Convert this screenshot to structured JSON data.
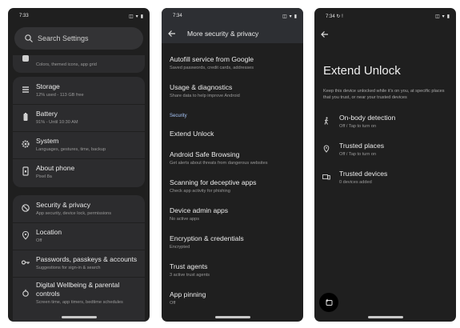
{
  "screen1": {
    "status": {
      "time": "7:33"
    },
    "search": {
      "placeholder": "Search Settings"
    },
    "partial_item": {
      "subtitle": "Colors, themed icons, app grid"
    },
    "items": [
      {
        "label": "Storage",
        "subtitle": "12% used - 113 GB free",
        "icon": "storage-icon"
      },
      {
        "label": "Battery",
        "subtitle": "91% - Until 10:30 AM",
        "icon": "battery-icon"
      },
      {
        "label": "System",
        "subtitle": "Languages, gestures, time, backup",
        "icon": "gear-icon"
      },
      {
        "label": "About phone",
        "subtitle": "Pixel 8a",
        "icon": "phone-icon"
      },
      {
        "label": "Security & privacy",
        "subtitle": "App security, device lock, permissions",
        "icon": "shield-icon"
      },
      {
        "label": "Location",
        "subtitle": "Off",
        "icon": "location-pin-icon"
      },
      {
        "label": "Passwords, passkeys & accounts",
        "subtitle": "Suggestions for sign-in & search",
        "icon": "key-icon"
      },
      {
        "label": "Digital Wellbeing & parental controls",
        "label_line1": "Digital Wellbeing & parental",
        "label_line2": "controls",
        "subtitle": "Screen time, app timers, bedtime schedules",
        "icon": "wellbeing-icon"
      }
    ]
  },
  "screen2": {
    "status": {
      "time": "7:34"
    },
    "title": "More security & privacy",
    "items_top": [
      {
        "label": "Autofill service from Google",
        "subtitle": "Saved passwords, credit cards, addresses"
      },
      {
        "label": "Usage & diagnostics",
        "subtitle": "Share data to help improve Android"
      }
    ],
    "section_label": "Security",
    "items_security": [
      {
        "label": "Extend Unlock",
        "subtitle": ""
      },
      {
        "label": "Android Safe Browsing",
        "subtitle": "Get alerts about threats from dangerous websites"
      },
      {
        "label": "Scanning for deceptive apps",
        "subtitle": "Check app activity for phishing"
      },
      {
        "label": "Device admin apps",
        "subtitle": "No active apps"
      },
      {
        "label": "Encryption & credentials",
        "subtitle": "Encrypted"
      },
      {
        "label": "Trust agents",
        "subtitle": "3 active trust agents"
      },
      {
        "label": "App pinning",
        "subtitle": "Off"
      }
    ]
  },
  "screen3": {
    "status": {
      "time": "7:34"
    },
    "title": "Extend Unlock",
    "description": "Keep this device unlocked while it's on you, at specific places that you trust, or near your trusted devices",
    "items": [
      {
        "label": "On-body detection",
        "subtitle": "Off / Tap to turn on",
        "icon": "walking-person-icon"
      },
      {
        "label": "Trusted places",
        "subtitle": "Off / Tap to turn on",
        "icon": "location-pin-icon"
      },
      {
        "label": "Trusted devices",
        "subtitle": "0 devices added",
        "icon": "devices-icon"
      }
    ]
  },
  "colors": {
    "background": "#1f1f1f",
    "card": "#2c2c2e",
    "accent": "#a8c7fa"
  }
}
